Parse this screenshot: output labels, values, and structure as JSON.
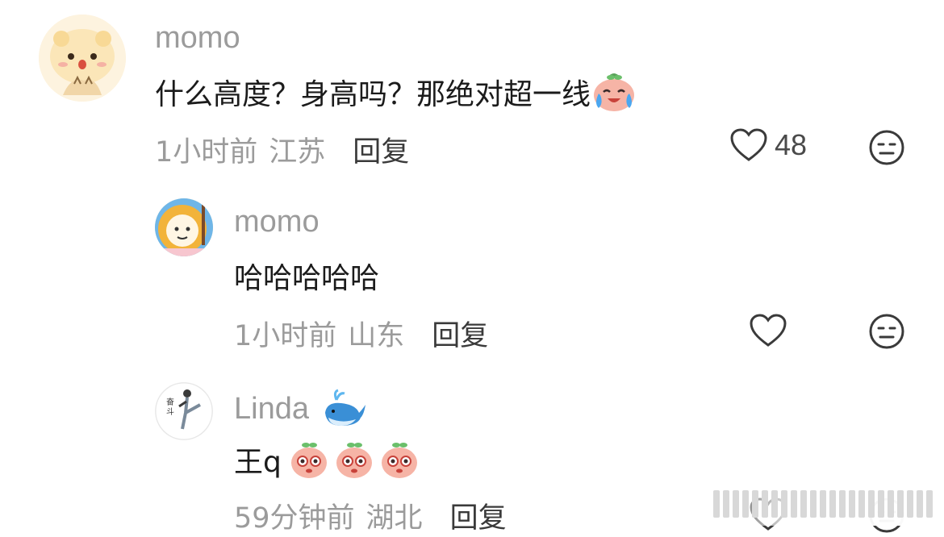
{
  "comments": [
    {
      "username": "momo",
      "text": "什么高度？身高吗？那绝对超一线",
      "time": "1小时前",
      "location": "江苏",
      "reply_label": "回复",
      "like_count": "48",
      "avatar_icon": "cartoon-bear-avatar",
      "emojis": [
        "crying-laughing-peach-emoji"
      ]
    },
    {
      "username": "momo",
      "text": "哈哈哈哈哈",
      "time": "1小时前",
      "location": "山东",
      "reply_label": "回复",
      "like_count": "",
      "avatar_icon": "cartoon-lion-avatar",
      "emojis": []
    },
    {
      "username": "Linda",
      "text": "王q",
      "time": "59分钟前",
      "location": "湖北",
      "reply_label": "回复",
      "like_count": "",
      "avatar_icon": "kicking-person-avatar",
      "emojis": [
        "teary-peach-emoji",
        "teary-peach-emoji",
        "teary-peach-emoji"
      ],
      "name_emoji": "whale-emoji"
    }
  ],
  "colors": {
    "meta_gray": "#9b9b9b",
    "text_dark": "#1b1b1b",
    "peach": "#f3a49b"
  }
}
